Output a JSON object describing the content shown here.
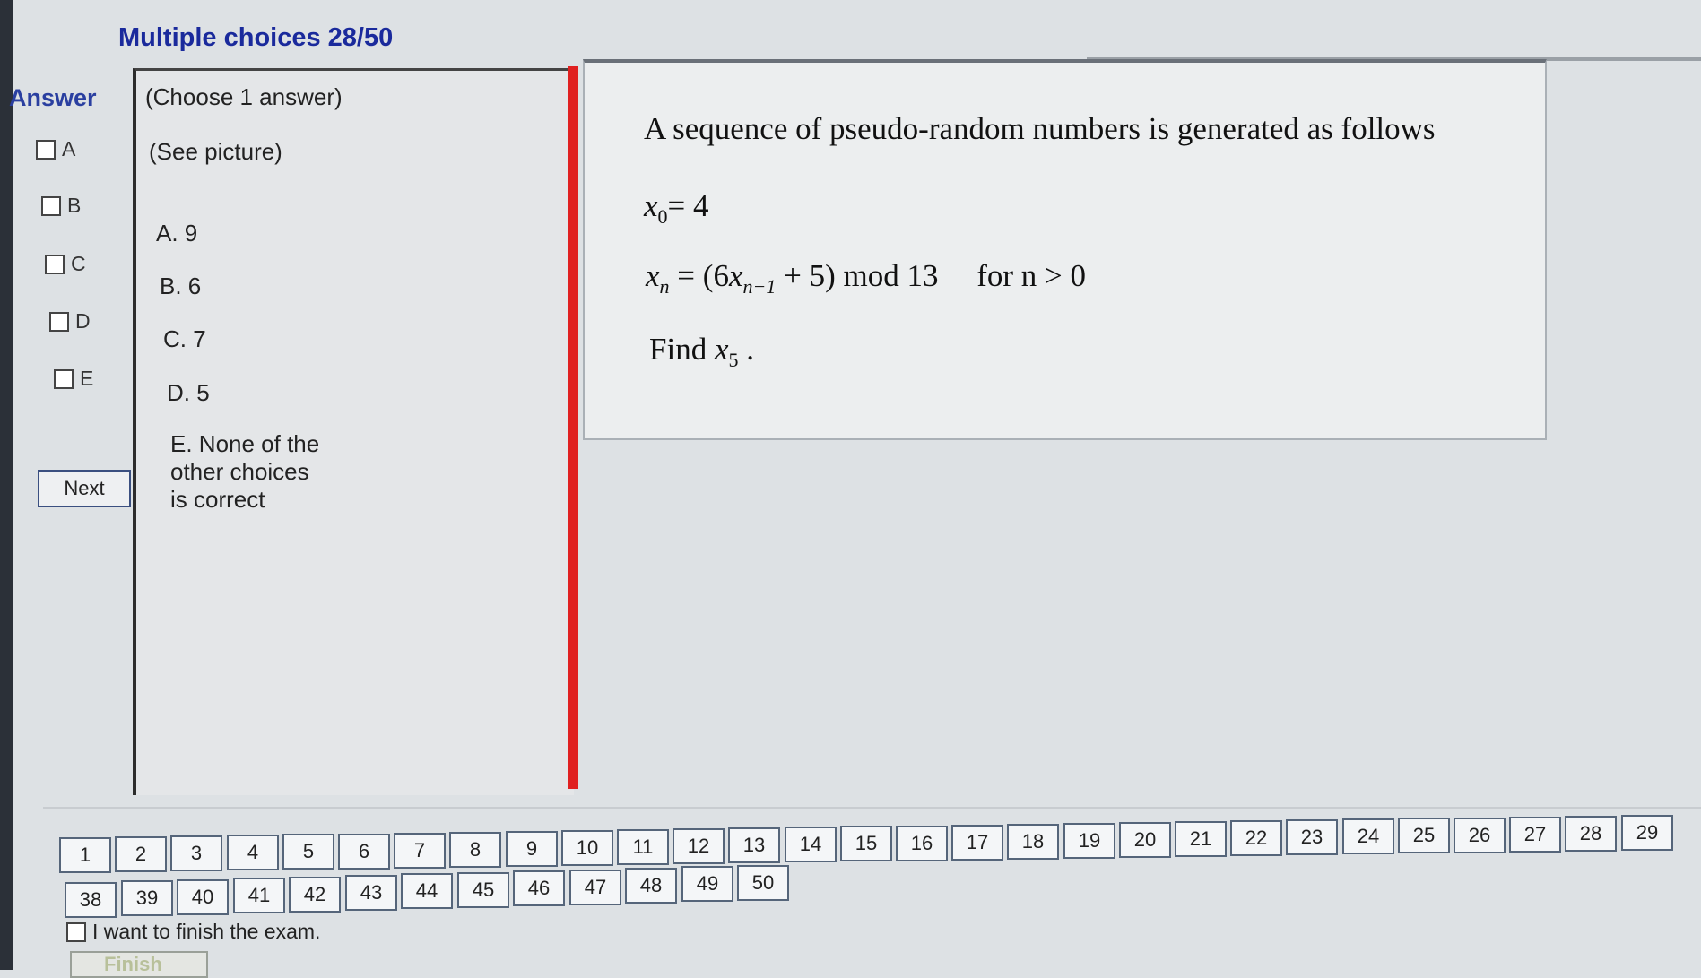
{
  "header": {
    "title": "Multiple choices 28/50"
  },
  "answer": {
    "label": "Answer",
    "options": [
      "A",
      "B",
      "C",
      "D",
      "E"
    ],
    "next_label": "Next"
  },
  "choices": {
    "instruction": "(Choose 1 answer)",
    "see_picture": "(See picture)",
    "items": [
      "A. 9",
      "B. 6",
      "C. 7",
      "D. 5",
      "E. None of the other choices is correct"
    ]
  },
  "question": {
    "intro": "A sequence of pseudo-random numbers is generated as follows",
    "x0_var": "x",
    "x0_sub": "0",
    "x0_rhs": "= 4",
    "rec_var": "x",
    "rec_sub": "n",
    "rec_eq": " = (6",
    "rec_var2": "x",
    "rec_sub2": "n−1",
    "rec_tail": " + 5) mod 13",
    "rec_cond": "for n > 0",
    "find_prefix": "Find ",
    "find_var": "x",
    "find_sub": "5",
    "find_suffix": " ."
  },
  "nav": {
    "numbers": [
      "1",
      "2",
      "3",
      "4",
      "5",
      "6",
      "7",
      "8",
      "9",
      "10",
      "11",
      "12",
      "13",
      "14",
      "15",
      "16",
      "17",
      "18",
      "19",
      "20",
      "21",
      "22",
      "23",
      "24",
      "25",
      "26",
      "27",
      "28",
      "29",
      "38",
      "39",
      "40",
      "41",
      "42",
      "43",
      "44",
      "45",
      "46",
      "47",
      "48",
      "49",
      "50"
    ]
  },
  "finish": {
    "checkbox_label": "I want to finish the exam.",
    "button_label": "Finish"
  }
}
